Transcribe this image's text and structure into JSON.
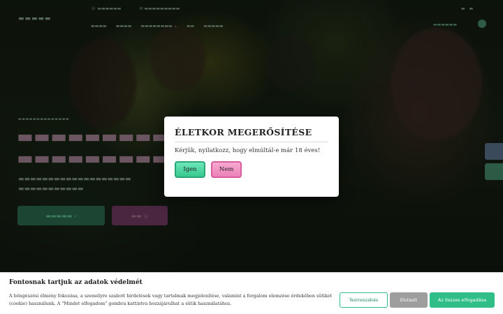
{
  "modal": {
    "title": "ÉLETKOR MEGERŐSÍTÉSE",
    "message": "Kérjük, nyilatkozz, hogy elmúltál-e már 18 éves!",
    "yes_label": "Igen",
    "no_label": "Nem"
  },
  "cookie_banner": {
    "title": "Fontosnak tartjuk az adatok védelmét",
    "text": "A böngészési élmény fokozása, a személyre szabott hirdetések vagy tartalmak megjelenítése, valamint a forgalom elemzése érdekében sütiket (cookie) használunk. A \"Mindet elfogadom\" gombra kattintva hozzájárulhat a sütik használatához.",
    "customize_label": "Testreszabás",
    "reject_label": "Elutasít",
    "accept_all_label": "Az összes elfogadása"
  },
  "colors": {
    "accent_green": "#2fbf86",
    "accent_pink": "#ec82b9",
    "reject_gray": "#9e9e9e"
  }
}
